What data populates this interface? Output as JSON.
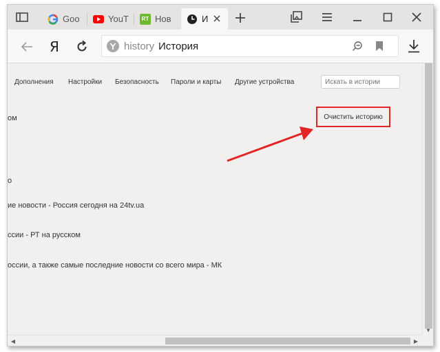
{
  "tabs": [
    {
      "title": "Goo",
      "icon": "google-icon"
    },
    {
      "title": "YouT",
      "icon": "youtube-icon"
    },
    {
      "title": "Нов",
      "icon": "rt-icon",
      "icon_text": "RT"
    },
    {
      "title": "И",
      "icon": "clock-icon",
      "active": true
    }
  ],
  "omnibox": {
    "scheme": "history",
    "title": "История"
  },
  "nav": {
    "yandex_label": "Я"
  },
  "menu": [
    "Дополнения",
    "Настройки",
    "Безопасность",
    "Пароли и карты",
    "Другие устройства"
  ],
  "search": {
    "placeholder": "Искать в истории"
  },
  "history": {
    "fragment_top": "ом",
    "fragment_mid": "о",
    "items": [
      "ие новости - Россия сегодня на 24tv.ua",
      "ссии - РТ на русском",
      "оссии, а также самые последние новости со всего мира - МК"
    ]
  },
  "clear_button": {
    "label": "Очистить историю"
  },
  "colors": {
    "highlight": "#e32424",
    "youtube": "#ff0000",
    "rt": "#6cb92c"
  }
}
